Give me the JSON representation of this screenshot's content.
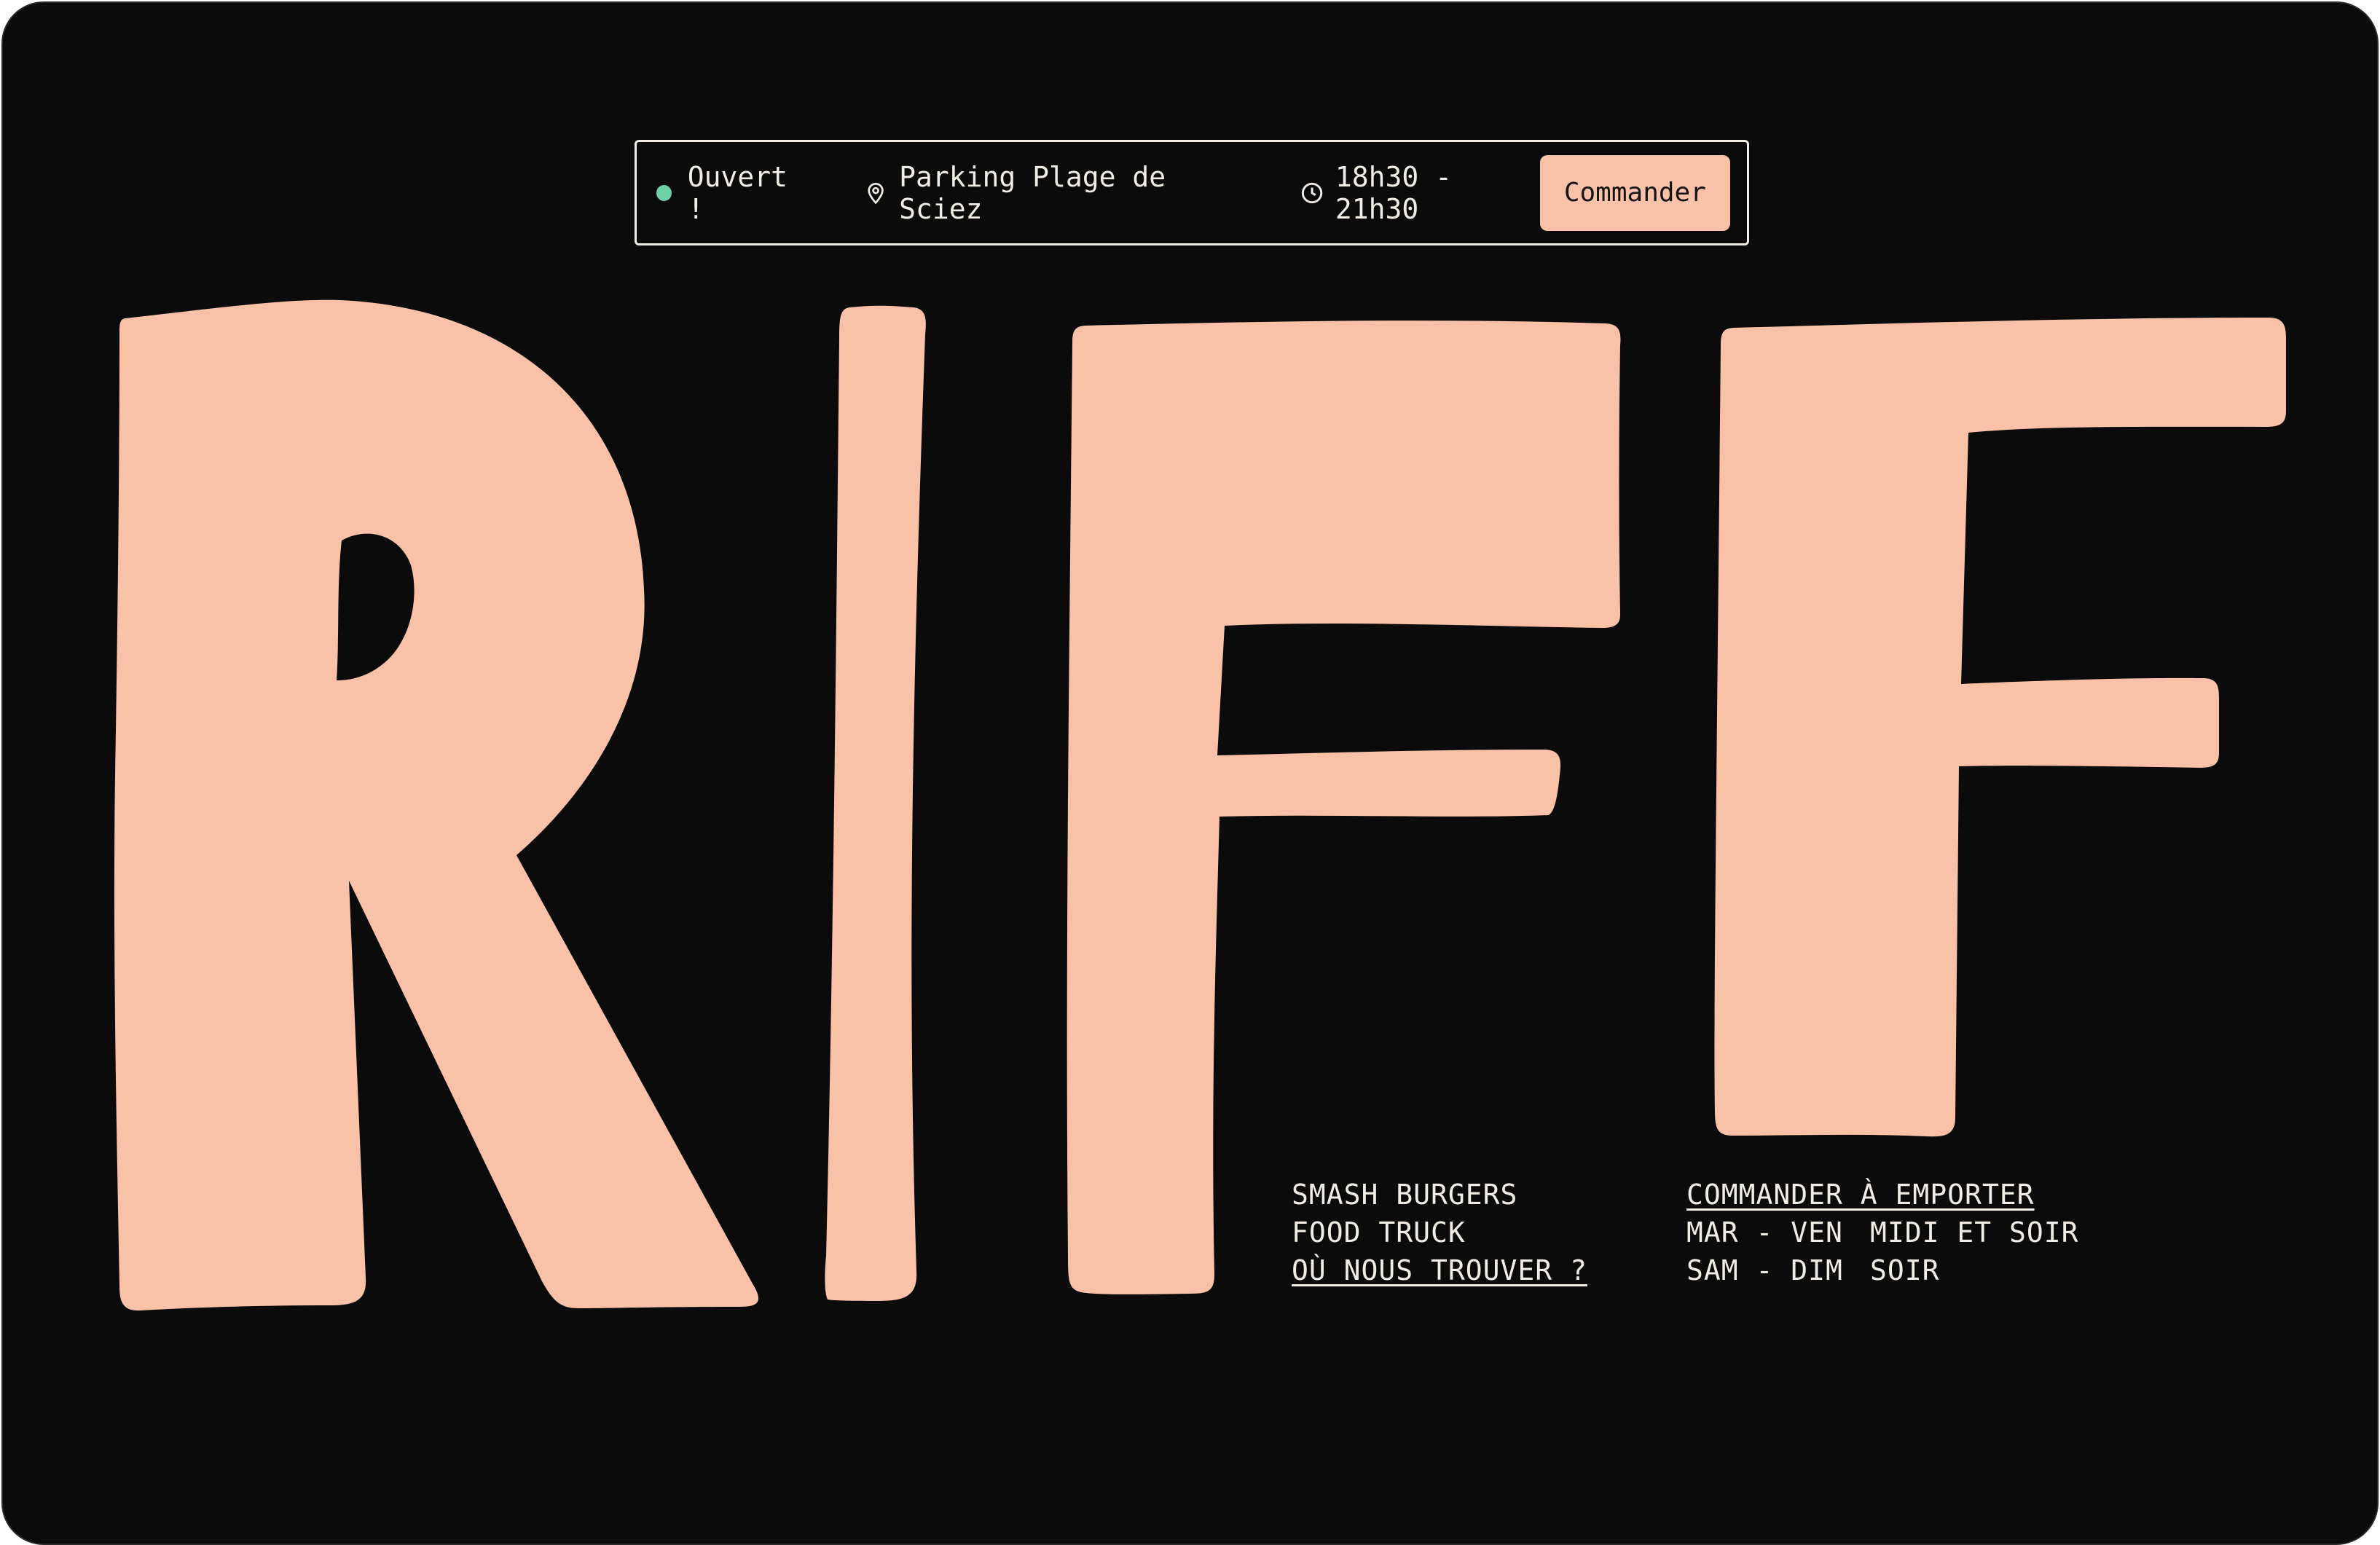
{
  "colors": {
    "background": "#0b0b0b",
    "logo": "#f9c1a8",
    "text": "#f1ece6",
    "status_open": "#6ed0a6",
    "button_bg": "#f9c1a8"
  },
  "topbar": {
    "status_label": "Ouvert !",
    "location_icon": "map-pin-icon",
    "location": "Parking Plage de Sciez",
    "hours_icon": "clock-icon",
    "hours": "18h30 - 21h30",
    "order_button": "Commander"
  },
  "logo": {
    "letters": [
      "R",
      "I",
      "F",
      "F"
    ]
  },
  "info": {
    "line1": "SMASH BURGERS",
    "line2": "FOOD TRUCK",
    "find_us_link": "OÙ NOUS TROUVER ?"
  },
  "schedule": {
    "takeaway_link": "COMMANDER À EMPORTER",
    "rows": [
      {
        "days": "MAR - VEN",
        "times": "MIDI ET SOIR"
      },
      {
        "days": "SAM - DIM",
        "times": "SOIR"
      }
    ]
  }
}
